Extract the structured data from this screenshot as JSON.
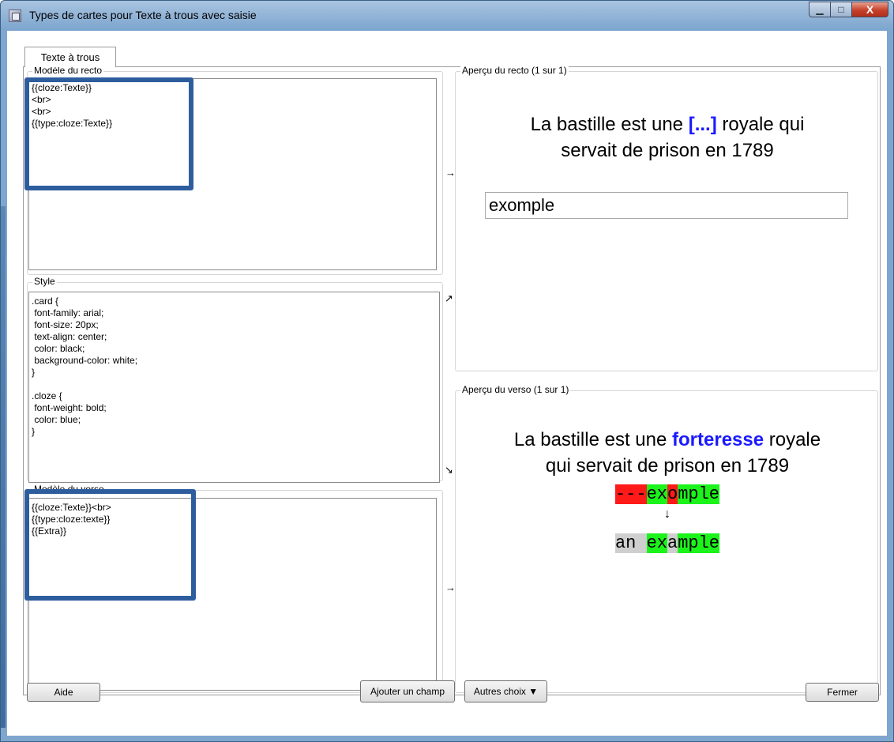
{
  "window": {
    "title": "Types de cartes pour Texte à trous avec saisie",
    "minimize_glyph": "▁",
    "maximize_glyph": "□",
    "close_glyph": "X"
  },
  "tabs": [
    {
      "label": "Texte à trous",
      "selected": true
    }
  ],
  "front_template": {
    "label": "Modèle du recto",
    "content": "{{cloze:Texte}}\n<br>\n<br>\n{{type:cloze:Texte}}",
    "arrow": "→"
  },
  "style": {
    "label": "Style",
    "content": ".card {\n font-family: arial;\n font-size: 20px;\n text-align: center;\n color: black;\n background-color: white;\n}\n\n.cloze {\n font-weight: bold;\n color: blue;\n}",
    "arrow_up": "↗",
    "arrow_down": "↘"
  },
  "back_template": {
    "label": "Modèle du verso",
    "content": "{{cloze:Texte}}<br>\n{{type:cloze:texte}}\n{{Extra}}",
    "arrow": "→"
  },
  "front_preview": {
    "label": "Aperçu du recto (1 sur 1)",
    "line1_prefix": "La bastille est une ",
    "cloze": "[...]",
    "line1_suffix": " royale qui",
    "line2": "servait de prison en 1789",
    "typed_answer": "exomple"
  },
  "back_preview": {
    "label": "Aperçu du verso (1 sur 1)",
    "line1_prefix": "La bastille est une ",
    "cloze": "forteresse",
    "line1_suffix": " royale",
    "line2": "qui servait de prison en 1789",
    "typed_segments": [
      {
        "text": "---",
        "status": "bad"
      },
      {
        "text": "ex",
        "status": "good"
      },
      {
        "text": "o",
        "status": "bad"
      },
      {
        "text": "mple",
        "status": "good"
      }
    ],
    "arrow": "↓",
    "expected_segments": [
      {
        "text": "an ",
        "status": "miss"
      },
      {
        "text": "ex",
        "status": "good"
      },
      {
        "text": "a",
        "status": "miss"
      },
      {
        "text": "mple",
        "status": "good"
      }
    ]
  },
  "buttons": {
    "help": "Aide",
    "add_field": "Ajouter un champ",
    "more": "Autres choix ▼",
    "close": "Fermer"
  },
  "colors": {
    "highlight_border": "#2e5d9e",
    "cloze_blue": "#1a1aff",
    "diff_bad": "#ff1a1a",
    "diff_good": "#1bf31b",
    "diff_missing": "#cfcfcf"
  }
}
